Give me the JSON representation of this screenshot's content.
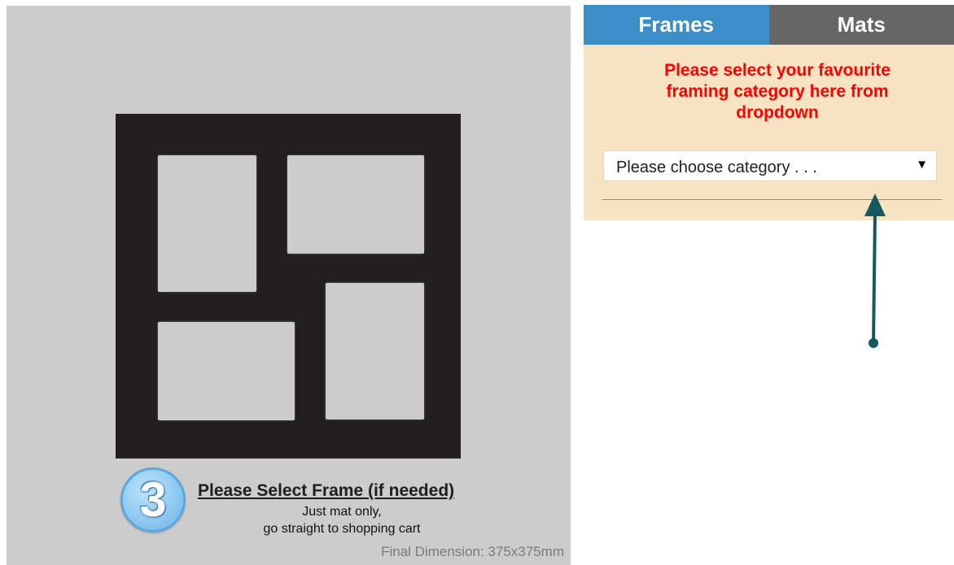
{
  "tabs": {
    "frames_label": "Frames",
    "mats_label": "Mats",
    "active": "Frames"
  },
  "panel": {
    "instruction": "Please select your favourite framing category here from dropdown",
    "category_select": {
      "value": "Please choose category . . .",
      "caret": "▼"
    }
  },
  "step": {
    "number": "3",
    "title": "Please Select Frame (if needed)",
    "line1": "Just mat only,",
    "line2": "go straight to shopping cart"
  },
  "final_dimension": "Final Dimension: 375x375mm",
  "colors": {
    "frames_tab": "#3b8ec7",
    "mats_tab": "#666666",
    "panel_bg": "#f7e2c1",
    "instruction_text": "#ff0000",
    "mat": "#231f20",
    "preview_bg": "#cccccc",
    "arrow": "#15595e"
  },
  "icons": {
    "dropdown": "caret-down-icon",
    "pointer": "up-arrow-icon"
  }
}
